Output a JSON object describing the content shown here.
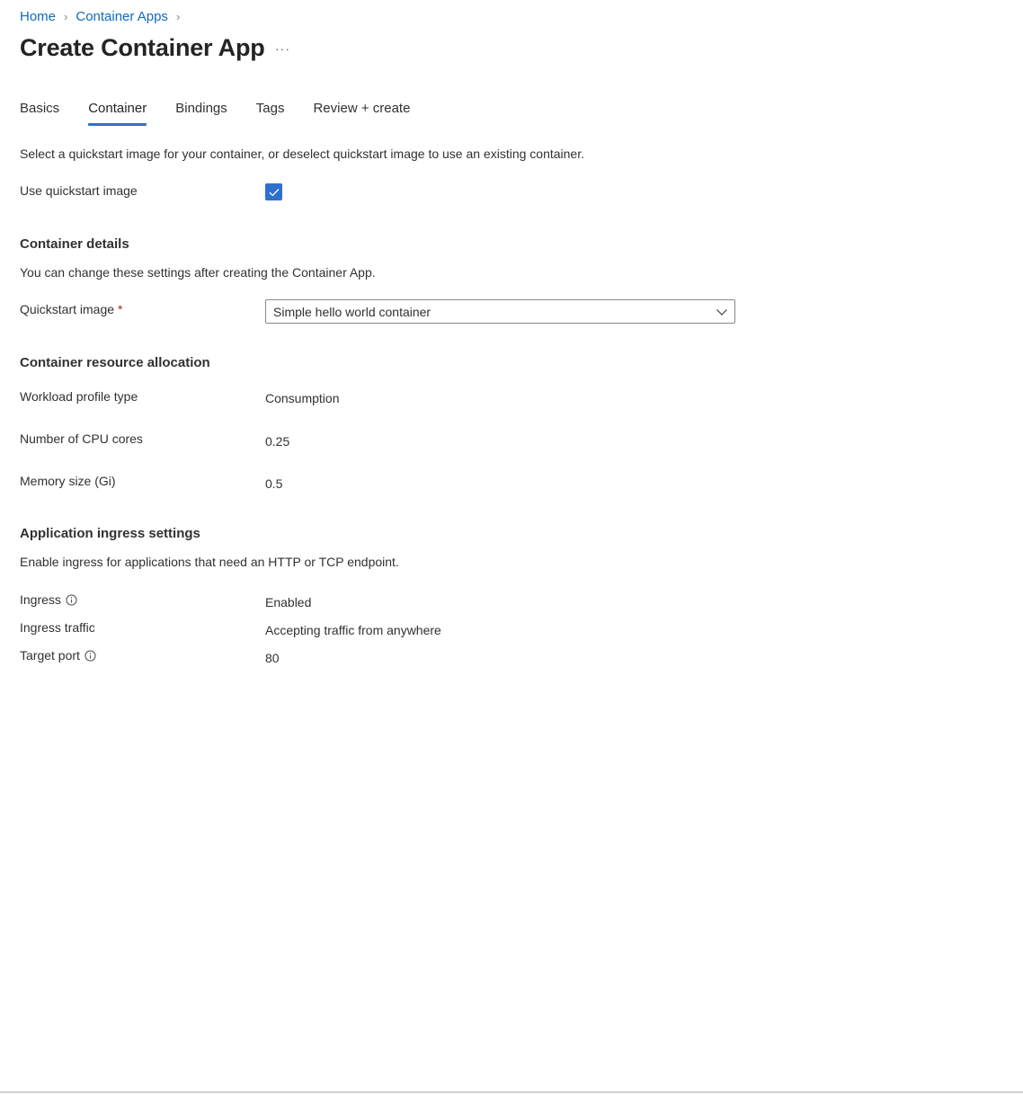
{
  "breadcrumb": [
    {
      "label": "Home"
    },
    {
      "label": "Container Apps"
    }
  ],
  "page": {
    "title": "Create Container App",
    "more_label": "···"
  },
  "tabs": [
    {
      "label": "Basics",
      "active": false
    },
    {
      "label": "Container",
      "active": true
    },
    {
      "label": "Bindings",
      "active": false
    },
    {
      "label": "Tags",
      "active": false
    },
    {
      "label": "Review + create",
      "active": false
    }
  ],
  "intro": "Select a quickstart image for your container, or deselect quickstart image to use an existing container.",
  "quickstart": {
    "label": "Use quickstart image",
    "checked": true
  },
  "container_details": {
    "heading": "Container details",
    "description": "You can change these settings after creating the Container App.",
    "quickstart_image_label": "Quickstart image",
    "required_marker": "*",
    "quickstart_image_value": "Simple hello world container"
  },
  "resource_allocation": {
    "heading": "Container resource allocation",
    "rows": [
      {
        "label": "Workload profile type",
        "value": "Consumption"
      },
      {
        "label": "Number of CPU cores",
        "value": "0.25"
      },
      {
        "label": "Memory size (Gi)",
        "value": "0.5"
      }
    ]
  },
  "ingress": {
    "heading": "Application ingress settings",
    "description": "Enable ingress for applications that need an HTTP or TCP endpoint.",
    "rows": [
      {
        "label": "Ingress",
        "value": "Enabled",
        "info": true
      },
      {
        "label": "Ingress traffic",
        "value": "Accepting traffic from anywhere",
        "info": false
      },
      {
        "label": "Target port",
        "value": "80",
        "info": true
      }
    ]
  },
  "colors": {
    "accent": "#2f6fcd",
    "link": "#0f6cbd",
    "required": "#a4262c"
  }
}
